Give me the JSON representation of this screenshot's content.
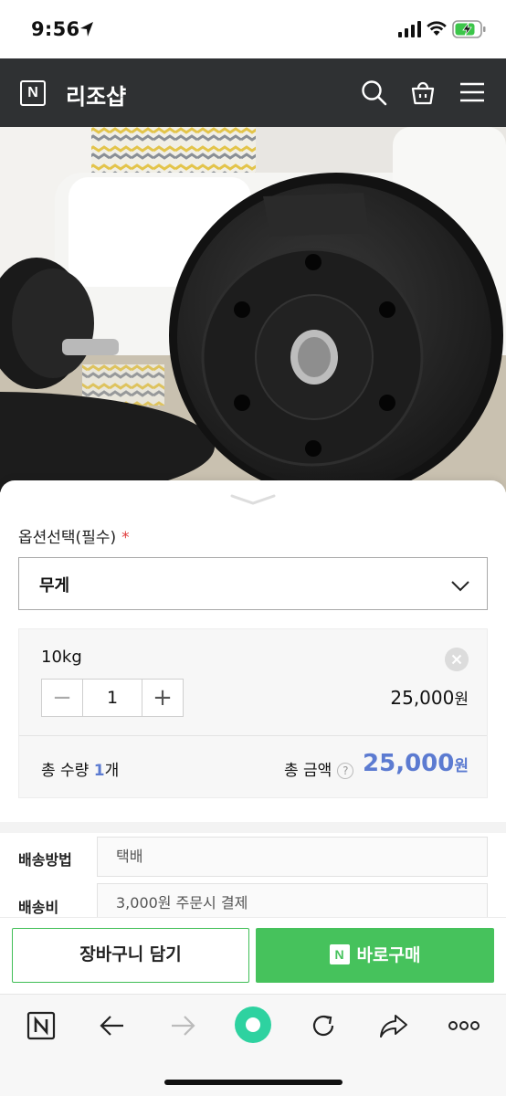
{
  "status_bar": {
    "time": "9:56"
  },
  "header": {
    "store_name": "리조샵"
  },
  "options": {
    "label": "옵션선택(필수)",
    "required_mark": "*",
    "select_value": "무게",
    "selected_item": {
      "name": "10kg",
      "quantity": "1",
      "price": "25,000",
      "won": "원"
    },
    "total_qty_prefix": "총 수량 ",
    "total_qty_value": "1",
    "total_qty_suffix": "개",
    "total_amount_label": "총 금액",
    "help_mark": "?",
    "total_amount": "25,000",
    "total_won": "원"
  },
  "delivery": [
    {
      "label": "배송방법",
      "value": "택배"
    },
    {
      "label": "배송비",
      "value": "3,000원 주문시 결제"
    }
  ],
  "actions": {
    "cart_label": "장바구니 담기",
    "buy_label": "바로구매",
    "buy_badge": "N"
  },
  "colors": {
    "header_bg": "#2f3133",
    "accent_blue": "#5c7bd1",
    "buy_green": "#46c25c",
    "required_red": "#e03b3b"
  },
  "icons": [
    "location-arrow-icon",
    "signal-icon",
    "wifi-icon",
    "battery-charging-icon",
    "naver-logo-icon",
    "search-icon",
    "shopping-bag-icon",
    "menu-icon",
    "chevron-down-icon",
    "close-icon",
    "back-icon",
    "forward-icon",
    "green-dot-icon",
    "refresh-icon",
    "share-icon",
    "more-icon"
  ]
}
